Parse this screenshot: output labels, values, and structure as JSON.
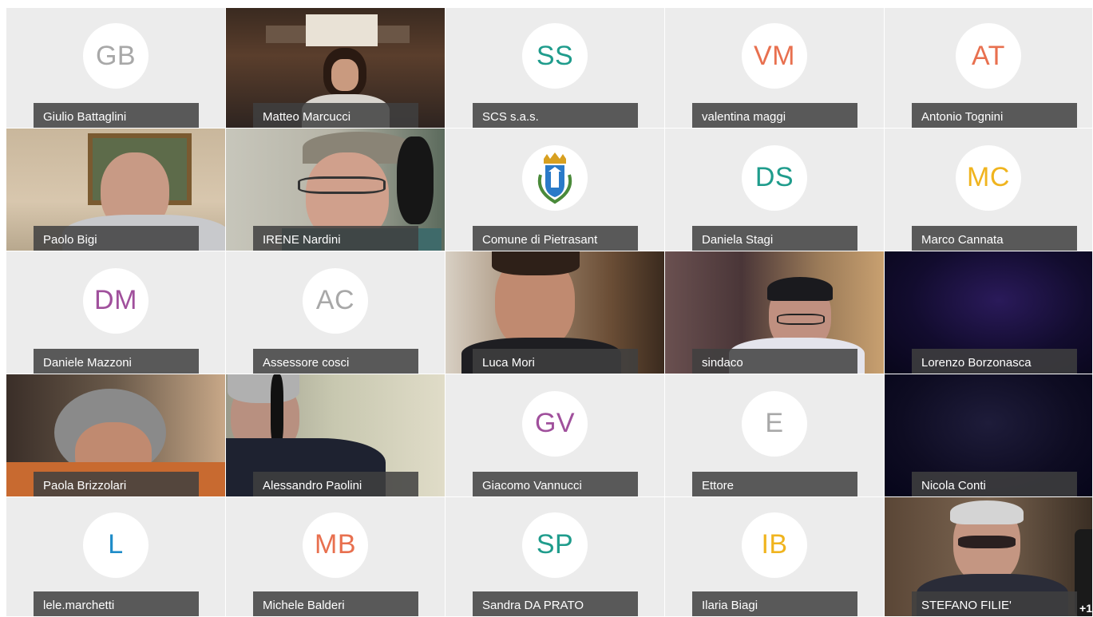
{
  "participants": [
    {
      "name": "Giulio Battaglini",
      "initials": "GB",
      "color": "#a8a8a8"
    },
    {
      "name": "Matteo Marcucci",
      "video": true
    },
    {
      "name": "SCS s.a.s.",
      "initials": "SS",
      "color": "#1f9c8c"
    },
    {
      "name": "valentina maggi",
      "initials": "VM",
      "color": "#e8704f"
    },
    {
      "name": "Antonio Tognini",
      "initials": "AT",
      "color": "#e8704f"
    },
    {
      "name": "Paolo Bigi",
      "video": true
    },
    {
      "name": "IRENE Nardini",
      "video": true
    },
    {
      "name": "Comune di Pietrasant",
      "logo": "coat-of-arms"
    },
    {
      "name": "Daniela Stagi",
      "initials": "DS",
      "color": "#1f9c8c"
    },
    {
      "name": "Marco Cannata",
      "initials": "MC",
      "color": "#f0b41e"
    },
    {
      "name": "Daniele Mazzoni",
      "initials": "DM",
      "color": "#a0509c"
    },
    {
      "name": "Assessore cosci",
      "initials": "AC",
      "color": "#a8a8a8"
    },
    {
      "name": "Luca Mori",
      "video": true
    },
    {
      "name": "sindaco",
      "video": true
    },
    {
      "name": "Lorenzo Borzonasca",
      "video": true
    },
    {
      "name": "Paola Brizzolari",
      "video": true
    },
    {
      "name": "Alessandro Paolini",
      "video": true
    },
    {
      "name": "Giacomo Vannucci",
      "initials": "GV",
      "color": "#a0509c"
    },
    {
      "name": "Ettore",
      "initials": "E",
      "color": "#a8a8a8"
    },
    {
      "name": "Nicola Conti",
      "video": true
    },
    {
      "name": "lele.marchetti",
      "initials": "L",
      "color": "#1f8cc8"
    },
    {
      "name": "Michele Balderi",
      "initials": "MB",
      "color": "#e8704f"
    },
    {
      "name": "Sandra DA PRATO",
      "initials": "SP",
      "color": "#1f9c8c"
    },
    {
      "name": "Ilaria Biagi",
      "initials": "IB",
      "color": "#f0b41e"
    },
    {
      "name": "STEFANO FILIE'",
      "video": true
    }
  ],
  "overflow_count": "+1"
}
